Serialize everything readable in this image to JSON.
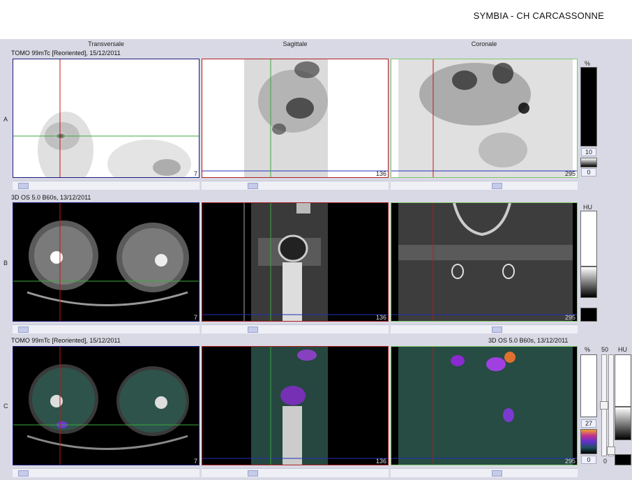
{
  "header": {
    "title": "SYMBIA - CH CARCASSONNE"
  },
  "columns": [
    "Transversale",
    "Sagittale",
    "Coronale"
  ],
  "rows": [
    {
      "letter": "A",
      "caption": "TOMO 99mTc [Reoriented], 15/12/2011",
      "right_caption": ""
    },
    {
      "letter": "B",
      "caption": "3D  OS  5.0  B60s, 13/12/2011",
      "right_caption": ""
    },
    {
      "letter": "C",
      "caption": "TOMO 99mTc [Reoriented], 15/12/2011",
      "right_caption": "3D  OS  5.0  B60s, 13/12/2011"
    }
  ],
  "slice_numbers": [
    "7",
    "136",
    "295"
  ],
  "scales": {
    "a": {
      "unit": "%",
      "value": "10",
      "min": "0"
    },
    "b": {
      "unit": "HU"
    },
    "c": {
      "unit": "%",
      "value": "27",
      "min": "0",
      "window_top": "50",
      "window_bottom": "0",
      "ct_unit": "HU"
    }
  },
  "colors": {
    "nm_background": "#ffffff",
    "ct_background": "#000000",
    "transverse_border": "#1a1a7a",
    "sagittal_border": "#b02020",
    "coronal_border": "#7ec86a",
    "crosshair_red": "#c81414",
    "crosshair_green": "#3caa3c",
    "crosshair_blue": "#2430b8"
  },
  "icons": [
    "scroll-thumb-icon",
    "window-slider-icon"
  ]
}
